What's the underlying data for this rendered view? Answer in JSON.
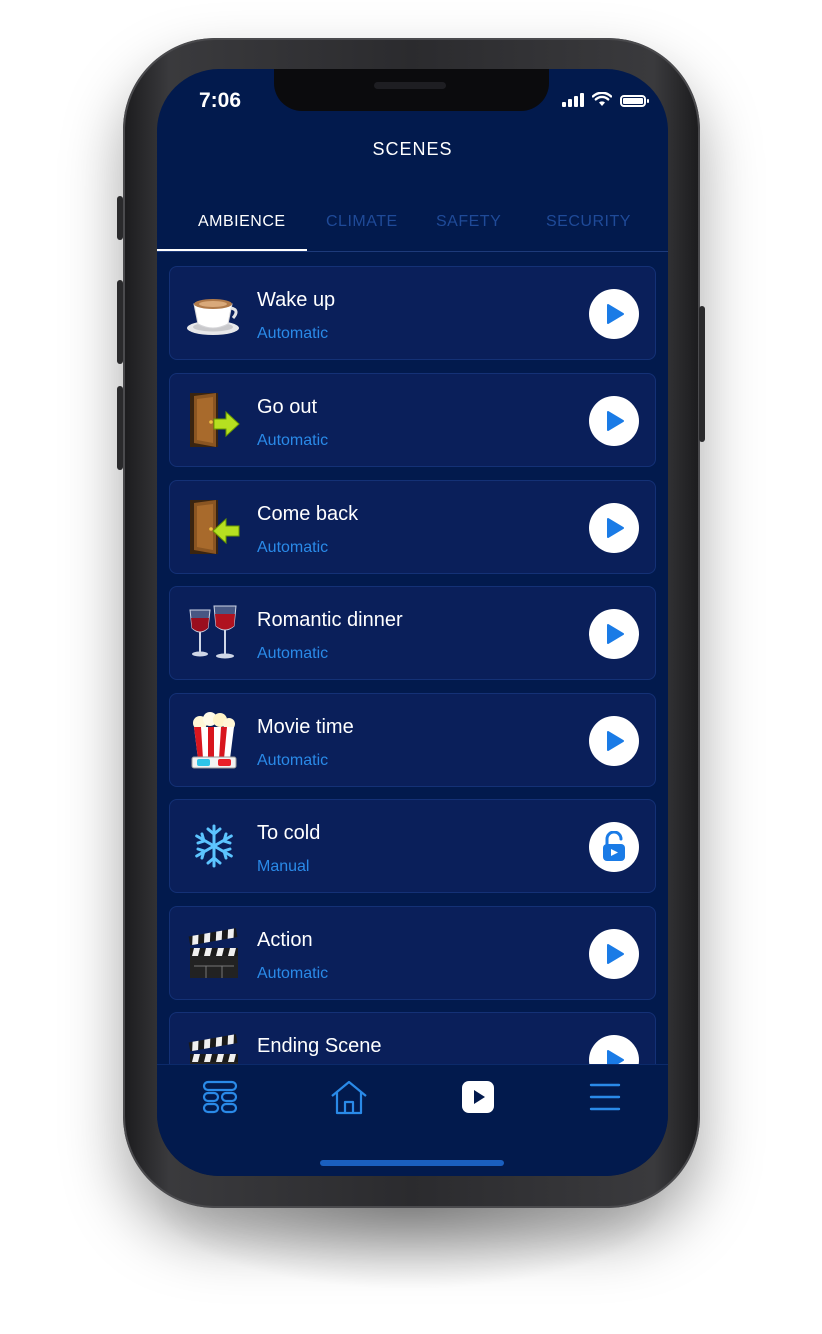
{
  "status": {
    "time": "7:06"
  },
  "header": {
    "title": "SCENES"
  },
  "tabs": [
    {
      "label": "AMBIENCE",
      "active": true
    },
    {
      "label": "CLIMATE",
      "active": false
    },
    {
      "label": "SAFETY",
      "active": false
    },
    {
      "label": "SECURITY",
      "active": false
    }
  ],
  "scenes": [
    {
      "name": "Wake up",
      "mode": "Automatic",
      "icon": "coffee-cup-icon",
      "action": "play-icon"
    },
    {
      "name": "Go out",
      "mode": "Automatic",
      "icon": "door-exit-icon",
      "action": "play-icon"
    },
    {
      "name": "Come back",
      "mode": "Automatic",
      "icon": "door-enter-icon",
      "action": "play-icon"
    },
    {
      "name": "Romantic dinner",
      "mode": "Automatic",
      "icon": "wine-glasses-icon",
      "action": "play-icon"
    },
    {
      "name": "Movie time",
      "mode": "Automatic",
      "icon": "popcorn-icon",
      "action": "play-icon"
    },
    {
      "name": "To cold",
      "mode": "Manual",
      "icon": "snowflake-icon",
      "action": "lock-icon"
    },
    {
      "name": "Action",
      "mode": "Automatic",
      "icon": "clapperboard-icon",
      "action": "play-icon"
    },
    {
      "name": "Ending Scene",
      "mode": "",
      "icon": "clapperboard-icon",
      "action": "play-icon"
    }
  ],
  "tabbar": [
    {
      "icon": "devices-icon",
      "active": false
    },
    {
      "icon": "home-icon",
      "active": false
    },
    {
      "icon": "scenes-play-icon",
      "active": true
    },
    {
      "icon": "menu-icon",
      "active": false
    }
  ],
  "colors": {
    "background": "#021a4d",
    "card": "#0a1f5a",
    "accent": "#2a8ae8",
    "inactive_tab": "#1f4a98"
  }
}
